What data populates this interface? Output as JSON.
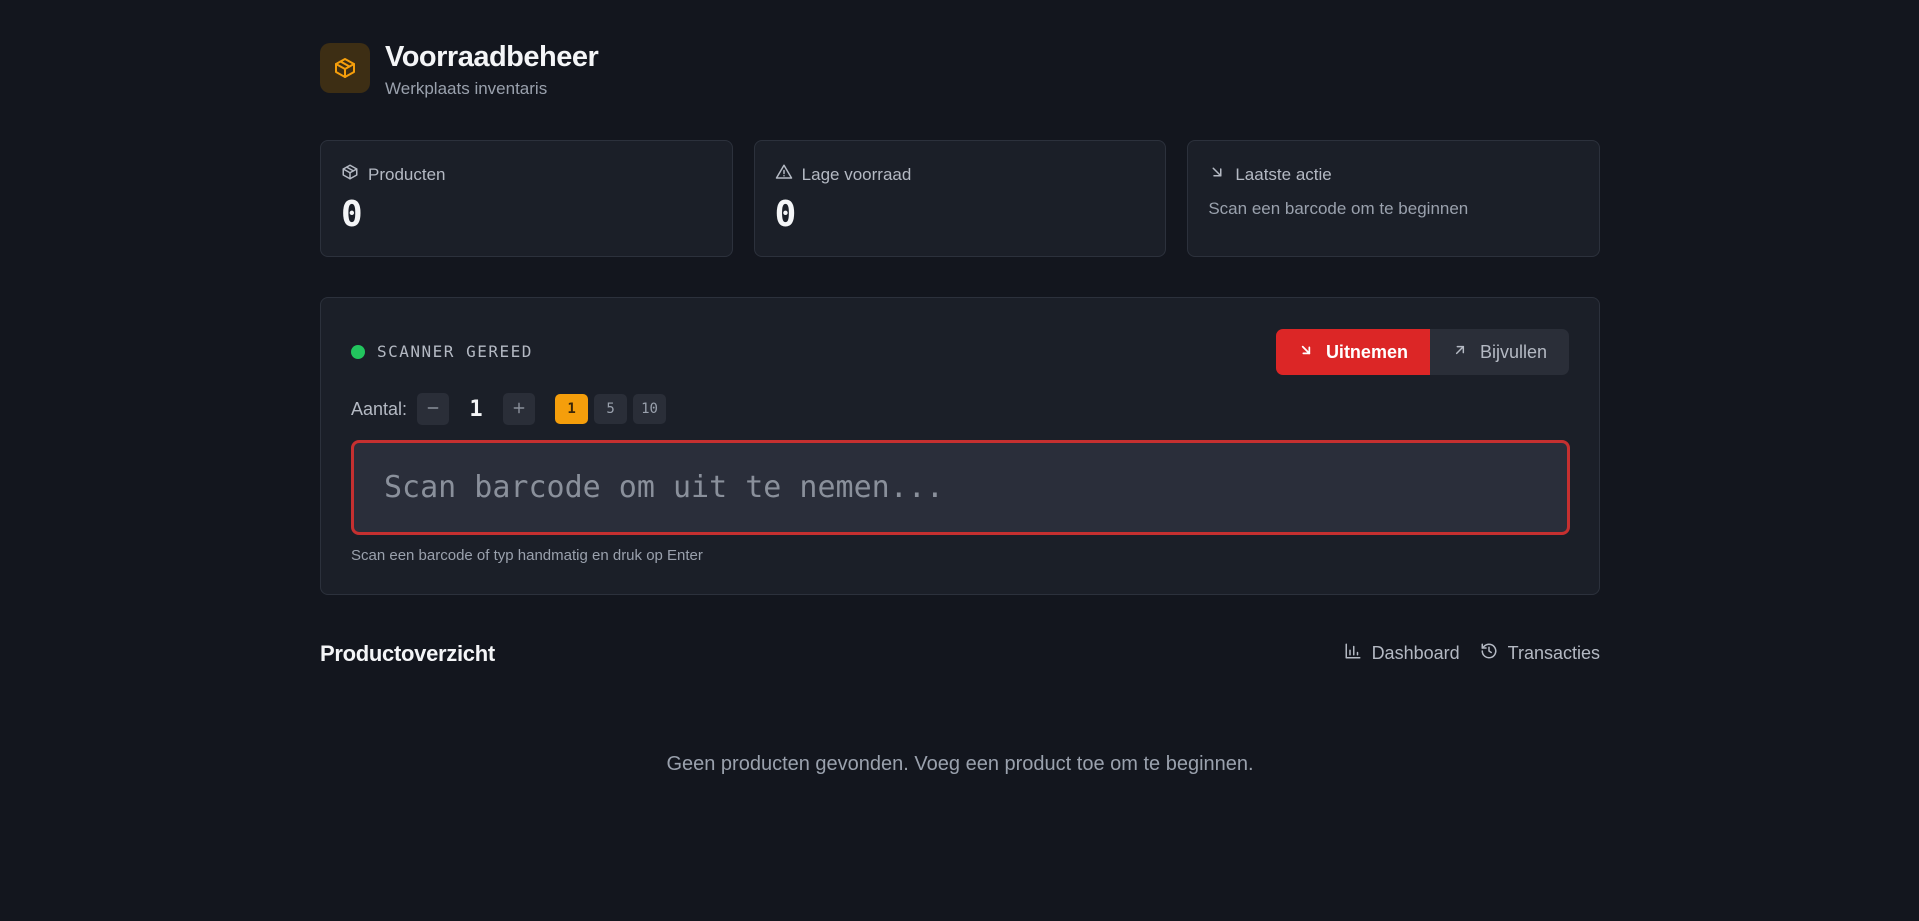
{
  "header": {
    "title": "Voorraadbeheer",
    "subtitle": "Werkplaats inventaris",
    "logo_icon": "package-icon",
    "accent": "#f59e0b"
  },
  "stats": [
    {
      "icon": "package-icon",
      "label": "Producten",
      "value": "0"
    },
    {
      "icon": "alert-triangle-icon",
      "label": "Lage voorraad",
      "value": "0"
    },
    {
      "icon": "arrow-down-right-icon",
      "label": "Laatste actie",
      "text": "Scan een barcode om te beginnen"
    }
  ],
  "scanner": {
    "status_label": "SCANNER GEREED",
    "status_color": "#22c55e",
    "mode_remove_label": "Uitnemen",
    "mode_refill_label": "Bijvullen",
    "active_color": "#dc2626",
    "quantity_label": "Aantal:",
    "quantity_value": "1",
    "presets": [
      "1",
      "5",
      "10"
    ],
    "input_value": "",
    "input_placeholder": "Scan barcode om uit te nemen...",
    "hint": "Scan een barcode of typ handmatig en druk op Enter"
  },
  "overview": {
    "title": "Productoverzicht",
    "dashboard_label": "Dashboard",
    "transactions_label": "Transacties",
    "empty_text": "Geen producten gevonden. Voeg een product toe om te beginnen."
  }
}
